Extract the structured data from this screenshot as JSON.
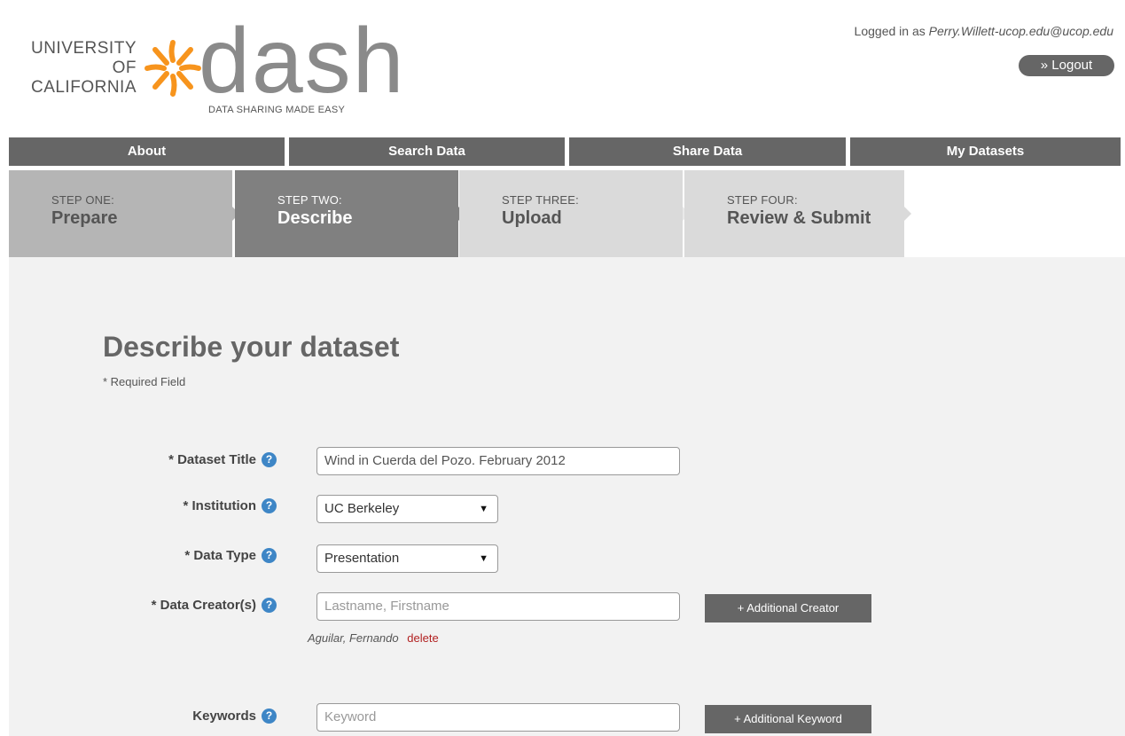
{
  "header": {
    "logo": {
      "uc_lines": [
        "UNIVERSITY",
        "OF",
        "CALIFORNIA"
      ],
      "wordmark": "dash",
      "tagline": "DATA SHARING MADE EASY"
    },
    "login_prefix": "Logged in as ",
    "login_user": "Perry.Willett-ucop.edu@ucop.edu",
    "logout_label": "» Logout"
  },
  "nav": {
    "items": [
      {
        "label": "About"
      },
      {
        "label": "Search Data"
      },
      {
        "label": "Share Data"
      },
      {
        "label": "My Datasets"
      }
    ]
  },
  "steps": [
    {
      "small": "STEP ONE:",
      "big": "Prepare"
    },
    {
      "small": "STEP TWO:",
      "big": "Describe"
    },
    {
      "small": "STEP THREE:",
      "big": "Upload"
    },
    {
      "small": "STEP FOUR:",
      "big": "Review & Submit"
    }
  ],
  "main": {
    "title": "Describe your dataset",
    "required_note": "* Required Field",
    "fields": {
      "dataset_title": {
        "label": "* Dataset Title",
        "value": "Wind in Cuerda del Pozo. February 2012"
      },
      "institution": {
        "label": "* Institution",
        "value": "UC Berkeley"
      },
      "data_type": {
        "label": "* Data Type",
        "value": "Presentation"
      },
      "data_creators": {
        "label": "* Data Creator(s)",
        "placeholder": "Lastname, Firstname",
        "button": "+ Additional Creator",
        "entries": [
          {
            "name": "Aguilar, Fernando",
            "delete": "delete"
          }
        ]
      },
      "keywords": {
        "label": "Keywords",
        "placeholder": "Keyword",
        "button": "+ Additional Keyword"
      }
    }
  },
  "colors": {
    "nav_bg": "#666666",
    "step_active": "#808080",
    "step_done": "#b5b5b5",
    "step_pending": "#dadada",
    "help_icon": "#3e86c6",
    "logo_sun": "#f7941d",
    "delete_link": "#b22222"
  }
}
